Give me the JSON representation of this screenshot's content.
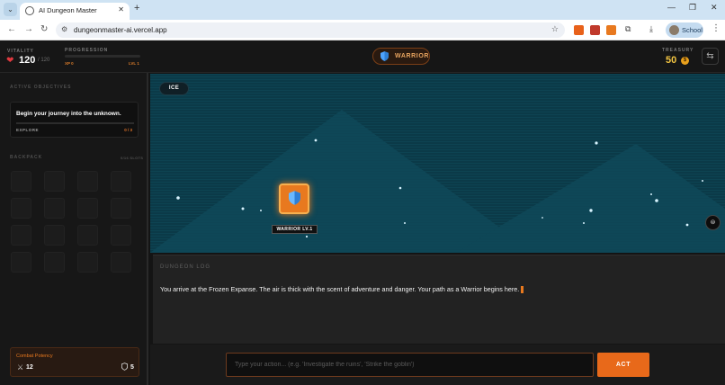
{
  "browser": {
    "tab_title": "AI Dungeon Master",
    "url": "dungeonmaster-ai.vercel.app",
    "profile_label": "School",
    "icons": {
      "tab_menu": "chevron-down-icon",
      "back": "back-arrow-icon",
      "forward": "forward-arrow-icon",
      "reload": "reload-icon",
      "site_info": "tune-icon",
      "bookmark": "star-icon",
      "extensions": "puzzle-icon",
      "downloads": "download-icon",
      "menu": "kebab-icon"
    },
    "glyphs": {
      "tab_menu": "⌄",
      "tab_close": "✕",
      "new_tab": "+",
      "minimize": "—",
      "maximize": "❐",
      "close": "✕",
      "back": "←",
      "forward": "→",
      "reload": "↻",
      "tune": "⚙",
      "star": "☆",
      "puzzle": "⧉",
      "download": "⤓",
      "kebab": "⋮"
    },
    "extension_colors": [
      "#e8611a",
      "#c0392b",
      "#e8791f"
    ]
  },
  "header": {
    "vitality_label": "VITALITY",
    "hp_current": "120",
    "hp_max": "/ 120",
    "progression_label": "PROGRESSION",
    "progress_fraction": 0.0,
    "xp_text": "XP 0",
    "level_text": "LVL 1",
    "class_name": "WARRIOR",
    "treasury_label": "TREASURY",
    "gold": "50",
    "coin_glyph": "$",
    "heart_glyph": "❤",
    "refresh_glyph": "⇆"
  },
  "left_panel": {
    "objectives_label": "ACTIVE OBJECTIVES",
    "quest_title": "Begin your journey into the unknown.",
    "quest_type": "EXPLORE",
    "quest_count": "0 / 3",
    "quest_progress": 0.0,
    "backpack_label": "BACKPACK",
    "backpack_count": "0/16 SLOTS",
    "backpack_slots": 16,
    "combat_label": "Combat Potency",
    "attack": "12",
    "defense": "5",
    "attack_glyph": "⚔"
  },
  "scene": {
    "biome": "ICE",
    "player_label": "WARRIOR LV.1",
    "map_toggle_glyph": "⊜",
    "colors": {
      "background": "#0b3a48",
      "mountain": "#0f4a5a",
      "accent": "#e8791f"
    }
  },
  "log": {
    "label": "DUNGEON LOG",
    "entry": "You arrive at the Frozen Expanse. The air is thick with the scent of adventure and danger. Your path as a Warrior begins here."
  },
  "action": {
    "placeholder": "Type your action... (e.g. 'Investigate the ruins', 'Strike the goblin')",
    "button_label": "ACT"
  }
}
